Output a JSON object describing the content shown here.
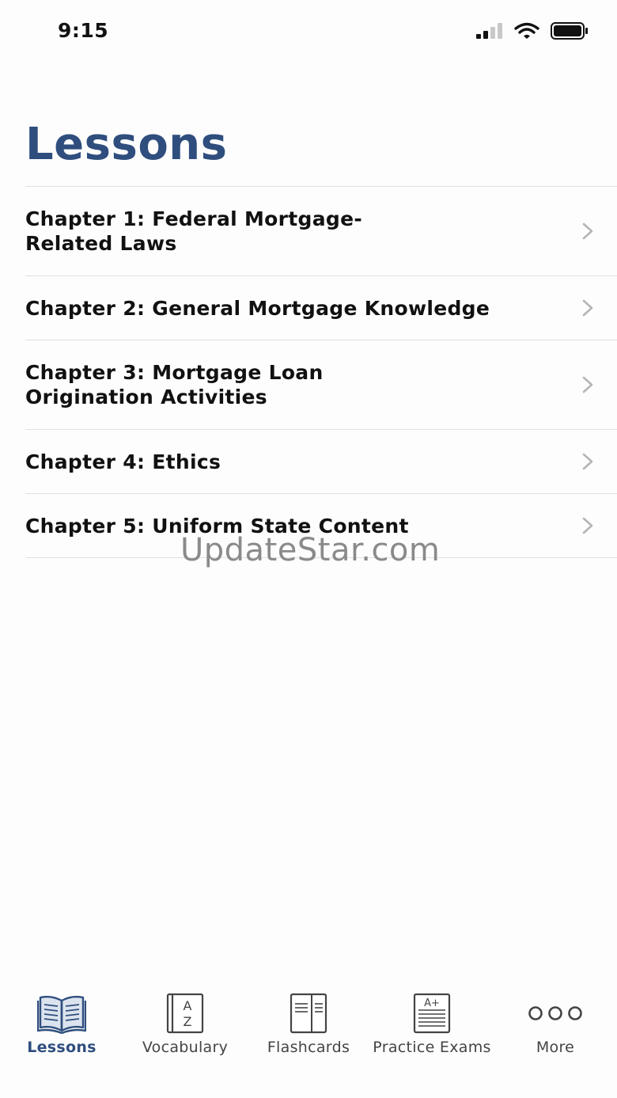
{
  "status_bar": {
    "time": "9:15"
  },
  "header": {
    "title": "Lessons"
  },
  "lessons": [
    {
      "label": "Chapter 1: Federal Mortgage-\nRelated Laws"
    },
    {
      "label": "Chapter 2: General Mortgage Knowledge"
    },
    {
      "label": "Chapter 3: Mortgage Loan\nOrigination Activities"
    },
    {
      "label": "Chapter 4: Ethics"
    },
    {
      "label": "Chapter 5: Uniform State Content"
    }
  ],
  "watermark": "UpdateStar.com",
  "tab_bar": {
    "tabs": [
      {
        "label": "Lessons",
        "icon": "open-book-icon"
      },
      {
        "label": "Vocabulary",
        "icon": "az-book-icon"
      },
      {
        "label": "Flashcards",
        "icon": "flashcards-icon"
      },
      {
        "label": "Practice Exams",
        "icon": "exam-paper-icon"
      },
      {
        "label": "More",
        "icon": "more-dots-icon"
      }
    ],
    "active": "Lessons"
  },
  "colors": {
    "accent": "#2f4e7e",
    "text": "#111111",
    "divider": "#e1e1e1",
    "chevron": "#b5b5b5"
  }
}
